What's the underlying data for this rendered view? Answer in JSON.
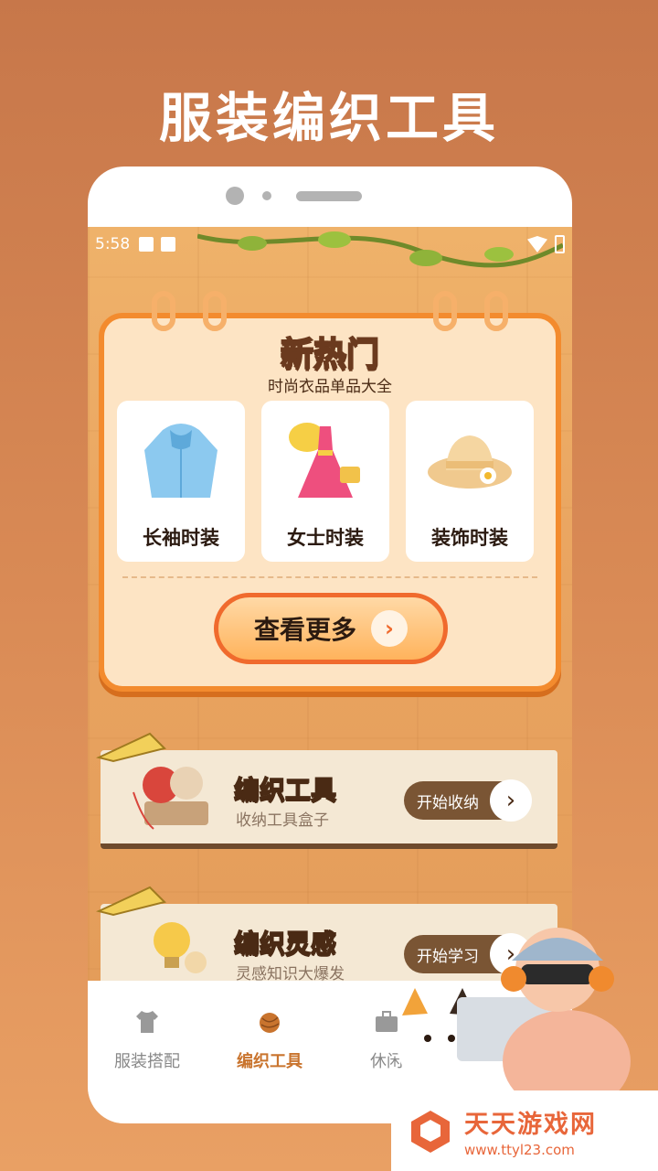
{
  "promo": {
    "title": "服装编织工具"
  },
  "status_bar": {
    "time": "5:58"
  },
  "hot_card": {
    "title": "新热门",
    "subtitle": "时尚衣品单品大全",
    "items": [
      {
        "label": "长袖时装",
        "icon": "hoodie-icon"
      },
      {
        "label": "女士时装",
        "icon": "dress-icon"
      },
      {
        "label": "装饰时装",
        "icon": "hat-icon"
      }
    ],
    "more_button": "查看更多"
  },
  "entries": [
    {
      "title": "编织工具",
      "subtitle": "收纳工具盒子",
      "button": "开始收纳",
      "icon": "yarn-icon"
    },
    {
      "title": "编织灵感",
      "subtitle": "灵感知识大爆发",
      "button": "开始学习",
      "icon": "lightbulb-icon"
    }
  ],
  "tabs": [
    {
      "label": "服装搭配",
      "icon": "shirt-icon",
      "active": false
    },
    {
      "label": "编织工具",
      "icon": "yarn-ball-icon",
      "active": true
    },
    {
      "label": "休闲",
      "icon": "briefcase-icon",
      "active": false
    }
  ],
  "watermark": {
    "brand": "天天游戏网",
    "url": "www.ttyl23.com"
  },
  "colors": {
    "accent": "#f38b2e",
    "brown": "#7a5534",
    "tab_active": "#c9742e"
  }
}
